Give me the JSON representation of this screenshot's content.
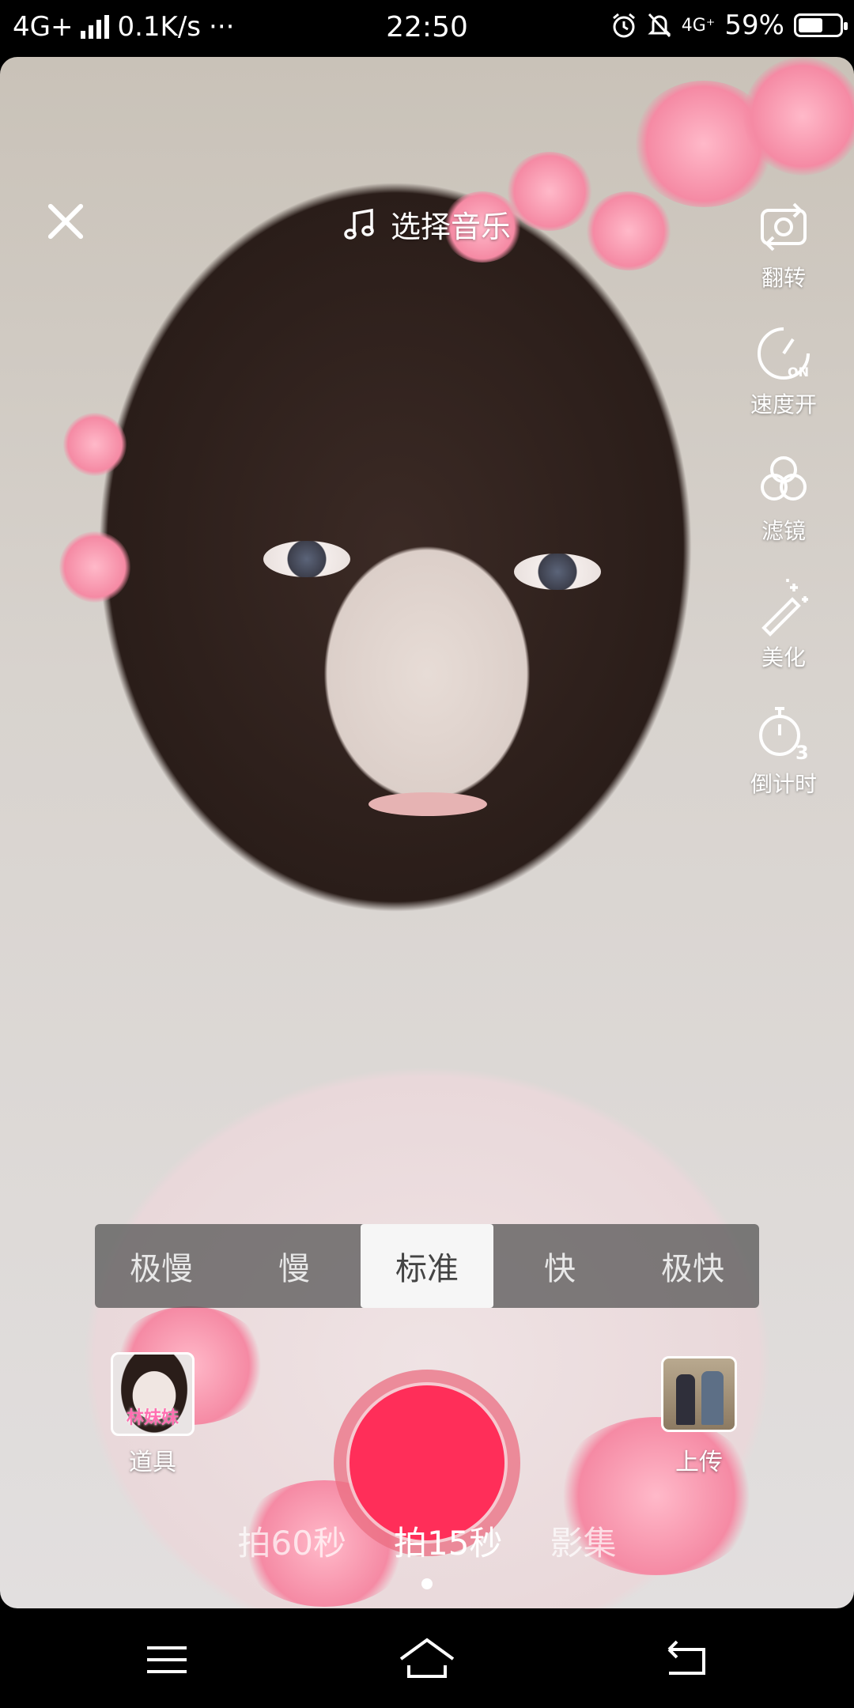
{
  "status_bar": {
    "network": "4G+",
    "speed": "0.1K/s",
    "dots": "···",
    "time": "22:50",
    "network_right": "4G⁺",
    "battery": "59%",
    "battery_level": 0.59
  },
  "top": {
    "music_label": "选择音乐"
  },
  "side_tools": [
    {
      "icon": "flip-camera-icon",
      "label": "翻转"
    },
    {
      "icon": "speed-icon",
      "label": "速度开"
    },
    {
      "icon": "filter-icon",
      "label": "滤镜"
    },
    {
      "icon": "beauty-wand-icon",
      "label": "美化"
    },
    {
      "icon": "countdown-timer-icon",
      "label": "倒计时"
    }
  ],
  "speed_options": [
    "极慢",
    "慢",
    "标准",
    "快",
    "极快"
  ],
  "speed_selected": "标准",
  "props": {
    "label": "道具",
    "thumb_text": "林妹妹"
  },
  "upload": {
    "label": "上传"
  },
  "modes": [
    {
      "label": "拍60秒",
      "active": false
    },
    {
      "label": "拍15秒",
      "active": true
    },
    {
      "label": "影集",
      "active": false
    }
  ],
  "colors": {
    "record": "#ff2e59",
    "record_ring": "#eb6e82"
  }
}
